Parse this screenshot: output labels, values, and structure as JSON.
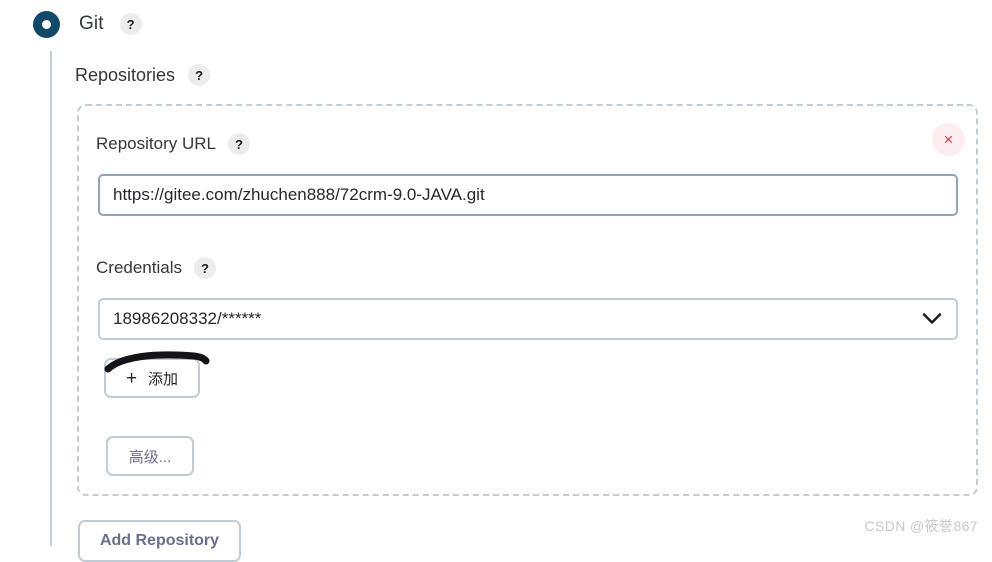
{
  "scm": {
    "selected": "Git",
    "help_glyph": "?"
  },
  "repositories_section": {
    "title": "Repositories",
    "help_glyph": "?"
  },
  "repository": {
    "url_label": "Repository URL",
    "url_help_glyph": "?",
    "url_value": "https://gitee.com/zhuchen888/72crm-9.0-JAVA.git",
    "url_placeholder": "",
    "credentials_label": "Credentials",
    "credentials_help_glyph": "?",
    "credentials_value": "18986208332/******",
    "remove_glyph": "×",
    "add_credentials_label": "添加",
    "add_credentials_plus": "+",
    "advanced_label": "高级..."
  },
  "actions": {
    "add_repository_label": "Add Repository"
  },
  "watermark": "CSDN @筱誉867",
  "colors": {
    "radio_selected": "#134869",
    "input_border_focus": "#91a4b1",
    "input_border": "#c0cbd3",
    "dashed_border": "#c3ccd4",
    "remove_icon": "#e2384e",
    "remove_bg": "#fceef0",
    "button_text": "#6b6f88",
    "watermark": "#c7c7c7"
  }
}
